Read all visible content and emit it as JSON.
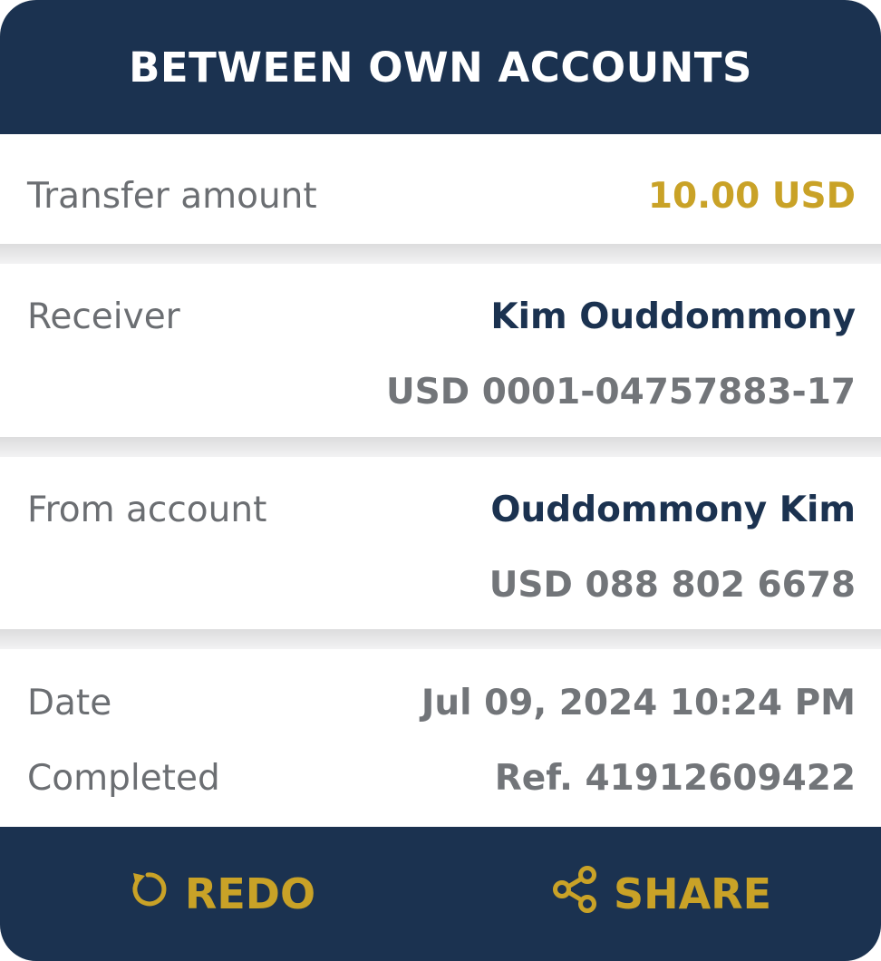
{
  "header": {
    "title": "BETWEEN OWN ACCOUNTS"
  },
  "amount": {
    "label": "Transfer amount",
    "value": "10.00 USD"
  },
  "receiver": {
    "label": "Receiver",
    "name": "Kim Ouddommony",
    "account": "USD 0001-04757883-17"
  },
  "from_account": {
    "label": "From account",
    "name": "Ouddommony Kim",
    "account": "USD 088 802 6678"
  },
  "details": {
    "date_label": "Date",
    "date_value": "Jul 09, 2024 10:24 PM",
    "status_label": "Completed",
    "reference": "Ref. 41912609422"
  },
  "footer": {
    "redo_label": "REDO",
    "redo_icon": "redo-icon",
    "share_label": "SHARE",
    "share_icon": "share-icon"
  },
  "colors": {
    "navy": "#1b3250",
    "gold": "#c9a227",
    "gray": "#6b6e72"
  }
}
